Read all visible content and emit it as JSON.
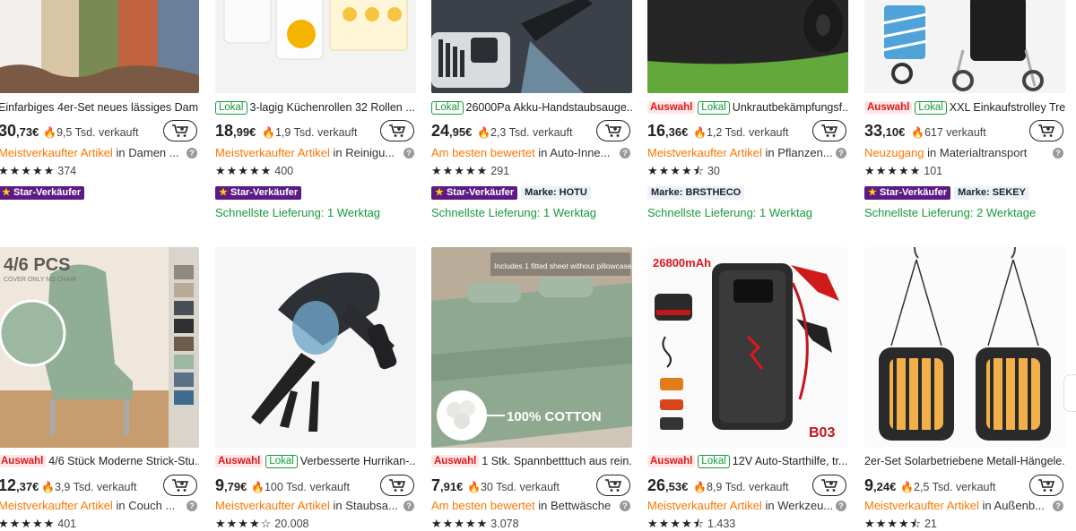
{
  "currency": "€",
  "labels": {
    "auswahl": "Auswahl",
    "lokal": "Lokal",
    "star_seller": "Star-Verkäufer",
    "in_word": "in",
    "info": "?"
  },
  "row1": [
    {
      "title": "Einfarbiges 4er-Set neues lässiges Dam...",
      "tags": [],
      "price_int": "30",
      "price_cents": ",73€",
      "sold": "9,5 Tsd. verkauft",
      "cat_highlight": "Meistverkaufter Artikel",
      "cat_rest": "Damen ...",
      "stars": "★★★★★",
      "rating_count": "374",
      "star_seller": true,
      "brand": "",
      "delivery": ""
    },
    {
      "title": "3-lagig Küchenrollen 32 Rollen ...",
      "tags": [
        "lokal"
      ],
      "price_int": "18",
      "price_cents": ",99€",
      "sold": "1,9 Tsd. verkauft",
      "cat_highlight": "Meistverkaufter Artikel",
      "cat_rest": "Reinigu...",
      "stars": "★★★★★",
      "rating_count": "400",
      "star_seller": true,
      "brand": "",
      "delivery": "Schnellste Lieferung: 1 Werktag"
    },
    {
      "title": "26000Pa Akku-Handstaubsauge...",
      "tags": [
        "lokal"
      ],
      "price_int": "24",
      "price_cents": ",95€",
      "sold": "2,3 Tsd. verkauft",
      "cat_highlight": "Am besten bewertet",
      "cat_rest": "Auto-Inne...",
      "stars": "★★★★★",
      "rating_count": "291",
      "star_seller": true,
      "brand": "Marke: HOTU",
      "delivery": "Schnellste Lieferung: 1 Werktag"
    },
    {
      "title": "Unkrautbekämpfungsf...",
      "tags": [
        "auswahl",
        "lokal"
      ],
      "price_int": "16",
      "price_cents": ",36€",
      "sold": "1,2 Tsd. verkauft",
      "cat_highlight": "Meistverkaufter Artikel",
      "cat_rest": "Pflanzen...",
      "stars": "★★★★⯪",
      "rating_count": "30",
      "star_seller": false,
      "brand": "Marke: BRSTHECO",
      "delivery": "Schnellste Lieferung: 1 Werktag"
    },
    {
      "title": "XXL Einkaufstrolley Tre...",
      "tags": [
        "auswahl",
        "lokal"
      ],
      "price_int": "33",
      "price_cents": ",10€",
      "sold": "617 verkauft",
      "cat_highlight": "Neuzugang",
      "cat_rest": "Materialtransport",
      "stars": "★★★★★",
      "rating_count": "101",
      "star_seller": true,
      "brand": "Marke: SEKEY",
      "delivery": "Schnellste Lieferung: 2 Werktage"
    }
  ],
  "row2": [
    {
      "title": "4/6 Stück Moderne Strick-Stu...",
      "tags": [
        "auswahl"
      ],
      "price_int": "12",
      "price_cents": ",37€",
      "sold": "3,9 Tsd. verkauft",
      "cat_highlight": "Meistverkaufter Artikel",
      "cat_rest": "Couch ...",
      "stars": "★★★★★",
      "rating_count": "401",
      "image_text": "4/6 PCS",
      "image_subtext": "COVER ONLY NO CHAIR"
    },
    {
      "title": "Verbesserte Hurrikan-...",
      "tags": [
        "auswahl",
        "lokal"
      ],
      "price_int": "9",
      "price_cents": ",79€",
      "sold": "100 Tsd. verkauft",
      "cat_highlight": "Meistverkaufter Artikel",
      "cat_rest": "Staubsa...",
      "stars": "★★★★☆",
      "rating_count": "20.008",
      "image_text": "",
      "image_subtext": ""
    },
    {
      "title": "1 Stk. Spannbetttuch aus rein...",
      "tags": [
        "auswahl"
      ],
      "price_int": "7",
      "price_cents": ",91€",
      "sold": "30 Tsd. verkauft",
      "cat_highlight": "Am besten bewertet",
      "cat_rest": "Bettwäsche",
      "stars": "★★★★★",
      "rating_count": "3.078",
      "image_text": "100% COTTON",
      "image_subtext": "Includes 1 fitted sheet without pillowcase"
    },
    {
      "title": "12V Auto-Starthilfe, tr...",
      "tags": [
        "auswahl",
        "lokal"
      ],
      "price_int": "26",
      "price_cents": ",53€",
      "sold": "8,9 Tsd. verkauft",
      "cat_highlight": "Meistverkaufter Artikel",
      "cat_rest": "Werkzeu...",
      "stars": "★★★★⯪",
      "rating_count": "1.433",
      "image_text": "26800mAh",
      "image_subtext": "B03"
    },
    {
      "title": "2er-Set Solarbetriebene Metall-Hängele...",
      "tags": [],
      "price_int": "9",
      "price_cents": ",24€",
      "sold": "2,5 Tsd. verkauft",
      "cat_highlight": "Meistverkaufter Artikel",
      "cat_rest": "Außenb...",
      "stars": "★★★★⯪",
      "rating_count": "21",
      "image_text": "",
      "image_subtext": ""
    }
  ]
}
